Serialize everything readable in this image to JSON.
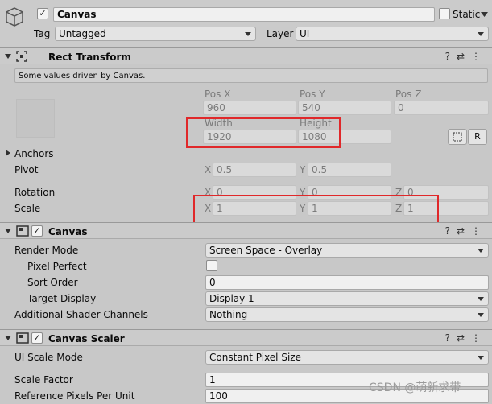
{
  "gameobject": {
    "active_check": "✓",
    "name": "Canvas",
    "static_label": "Static",
    "tag_label": "Tag",
    "tag_value": "Untagged",
    "layer_label": "Layer",
    "layer_value": "UI"
  },
  "rect_transform": {
    "title": "Rect Transform",
    "notice": "Some values driven by Canvas.",
    "pos_x_label": "Pos X",
    "pos_y_label": "Pos Y",
    "pos_z_label": "Pos Z",
    "pos_x": "960",
    "pos_y": "540",
    "pos_z": "0",
    "width_label": "Width",
    "height_label": "Height",
    "width": "1920",
    "height": "1080",
    "r_button": "R",
    "anchors_label": "Anchors",
    "pivot_label": "Pivot",
    "pivot_x_label": "X",
    "pivot_x": "0.5",
    "pivot_y_label": "Y",
    "pivot_y": "0.5",
    "rotation_label": "Rotation",
    "rot_x_label": "X",
    "rot_x": "0",
    "rot_y_label": "Y",
    "rot_y": "0",
    "rot_z_label": "Z",
    "rot_z": "0",
    "scale_label": "Scale",
    "scale_x_label": "X",
    "scale_x": "1",
    "scale_y_label": "Y",
    "scale_y": "1",
    "scale_z_label": "Z",
    "scale_z": "1"
  },
  "canvas": {
    "enabled_check": "✓",
    "title": "Canvas",
    "render_mode_label": "Render Mode",
    "render_mode": "Screen Space - Overlay",
    "pixel_perfect_label": "Pixel Perfect",
    "sort_order_label": "Sort Order",
    "sort_order": "0",
    "target_display_label": "Target Display",
    "target_display": "Display 1",
    "shader_channels_label": "Additional Shader Channels",
    "shader_channels": "Nothing"
  },
  "canvas_scaler": {
    "enabled_check": "✓",
    "title": "Canvas Scaler",
    "ui_scale_mode_label": "UI Scale Mode",
    "ui_scale_mode": "Constant Pixel Size",
    "scale_factor_label": "Scale Factor",
    "scale_factor": "1",
    "ref_ppu_label": "Reference Pixels Per Unit",
    "ref_ppu": "100"
  },
  "header_icons": {
    "help": "?",
    "presets": "⇄",
    "more": "⋮"
  },
  "watermark": "CSDN @萌新求带",
  "colors": {
    "highlight_box": "#e0282a",
    "panel_bg": "#c8c8c8"
  }
}
